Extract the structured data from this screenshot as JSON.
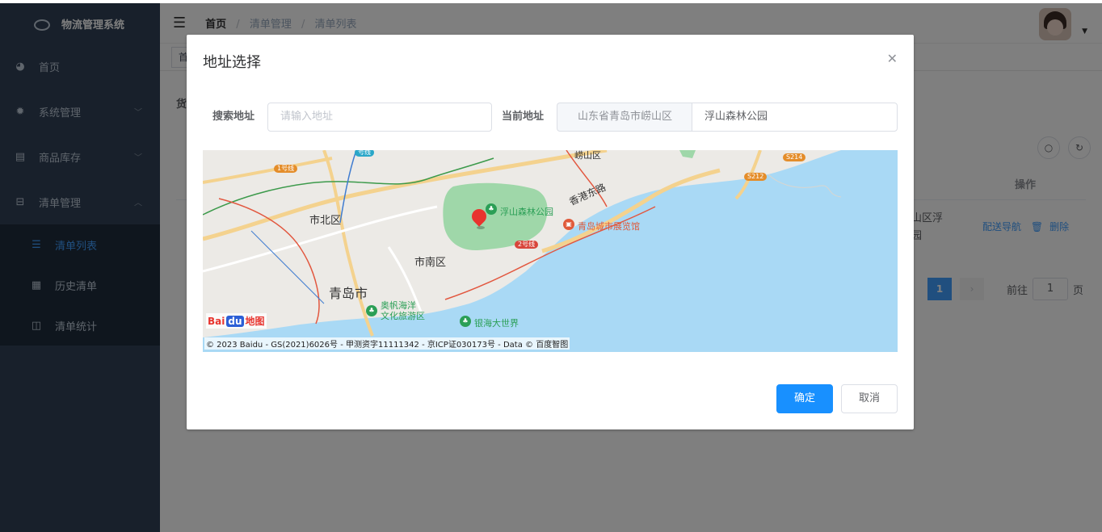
{
  "app": {
    "title": "物流管理系统"
  },
  "sidebar": {
    "items": [
      {
        "label": "首页",
        "icon": "dashboard-icon"
      },
      {
        "label": "系统管理",
        "icon": "gear-icon"
      },
      {
        "label": "商品库存",
        "icon": "box-icon"
      },
      {
        "label": "清单管理",
        "icon": "list-icon"
      }
    ],
    "subitems": [
      {
        "label": "清单列表",
        "icon": "list-lines-icon",
        "active": true
      },
      {
        "label": "历史清单",
        "icon": "grid-icon"
      },
      {
        "label": "清单统计",
        "icon": "table-icon"
      }
    ]
  },
  "navbar": {
    "breadcrumb": [
      "首页",
      "清单管理",
      "清单列表"
    ],
    "separator": "/"
  },
  "tags": {
    "first": "首"
  },
  "content": {
    "partial_label": "货",
    "op_header": "操作",
    "row_address": "山区浮\n园",
    "row_actions": [
      "配送导航",
      "删除"
    ]
  },
  "pagination": {
    "current": "1",
    "goto_label": "前往",
    "goto_value": "1",
    "page_suffix": "页"
  },
  "dialog": {
    "title": "地址选择",
    "search_label": "搜索地址",
    "search_placeholder": "请输入地址",
    "current_label": "当前地址",
    "current_region": "山东省青岛市崂山区",
    "current_value": "浮山森林公园",
    "confirm": "确定",
    "cancel": "取消"
  },
  "map": {
    "labels": {
      "shibei": "市北区",
      "shinan": "市南区",
      "qingdao": "青岛市",
      "fushan": "浮山森林公园",
      "hongkong_rd": "香港东路",
      "exhibition": "青岛城市展览馆",
      "olympic": "奥帆海洋\n文化旅游区",
      "yinhai": "银海大世界",
      "laoshan": "崂山区",
      "line1": "1号线",
      "line2": "2号线",
      "line_top": "号线",
      "s212": "S212",
      "s214": "S214"
    },
    "logo": [
      "Bai",
      "du",
      "地图"
    ],
    "copyright": "© 2023 Baidu - GS(2021)6026号 - 甲测资字11111342 - 京ICP证030173号 - Data © 百度智图"
  },
  "colors": {
    "sidebar_bg": "#304156",
    "accent": "#409eff",
    "primary_button": "#1890ff",
    "sea": "#a9d9f5",
    "park": "#9fd7a9"
  }
}
